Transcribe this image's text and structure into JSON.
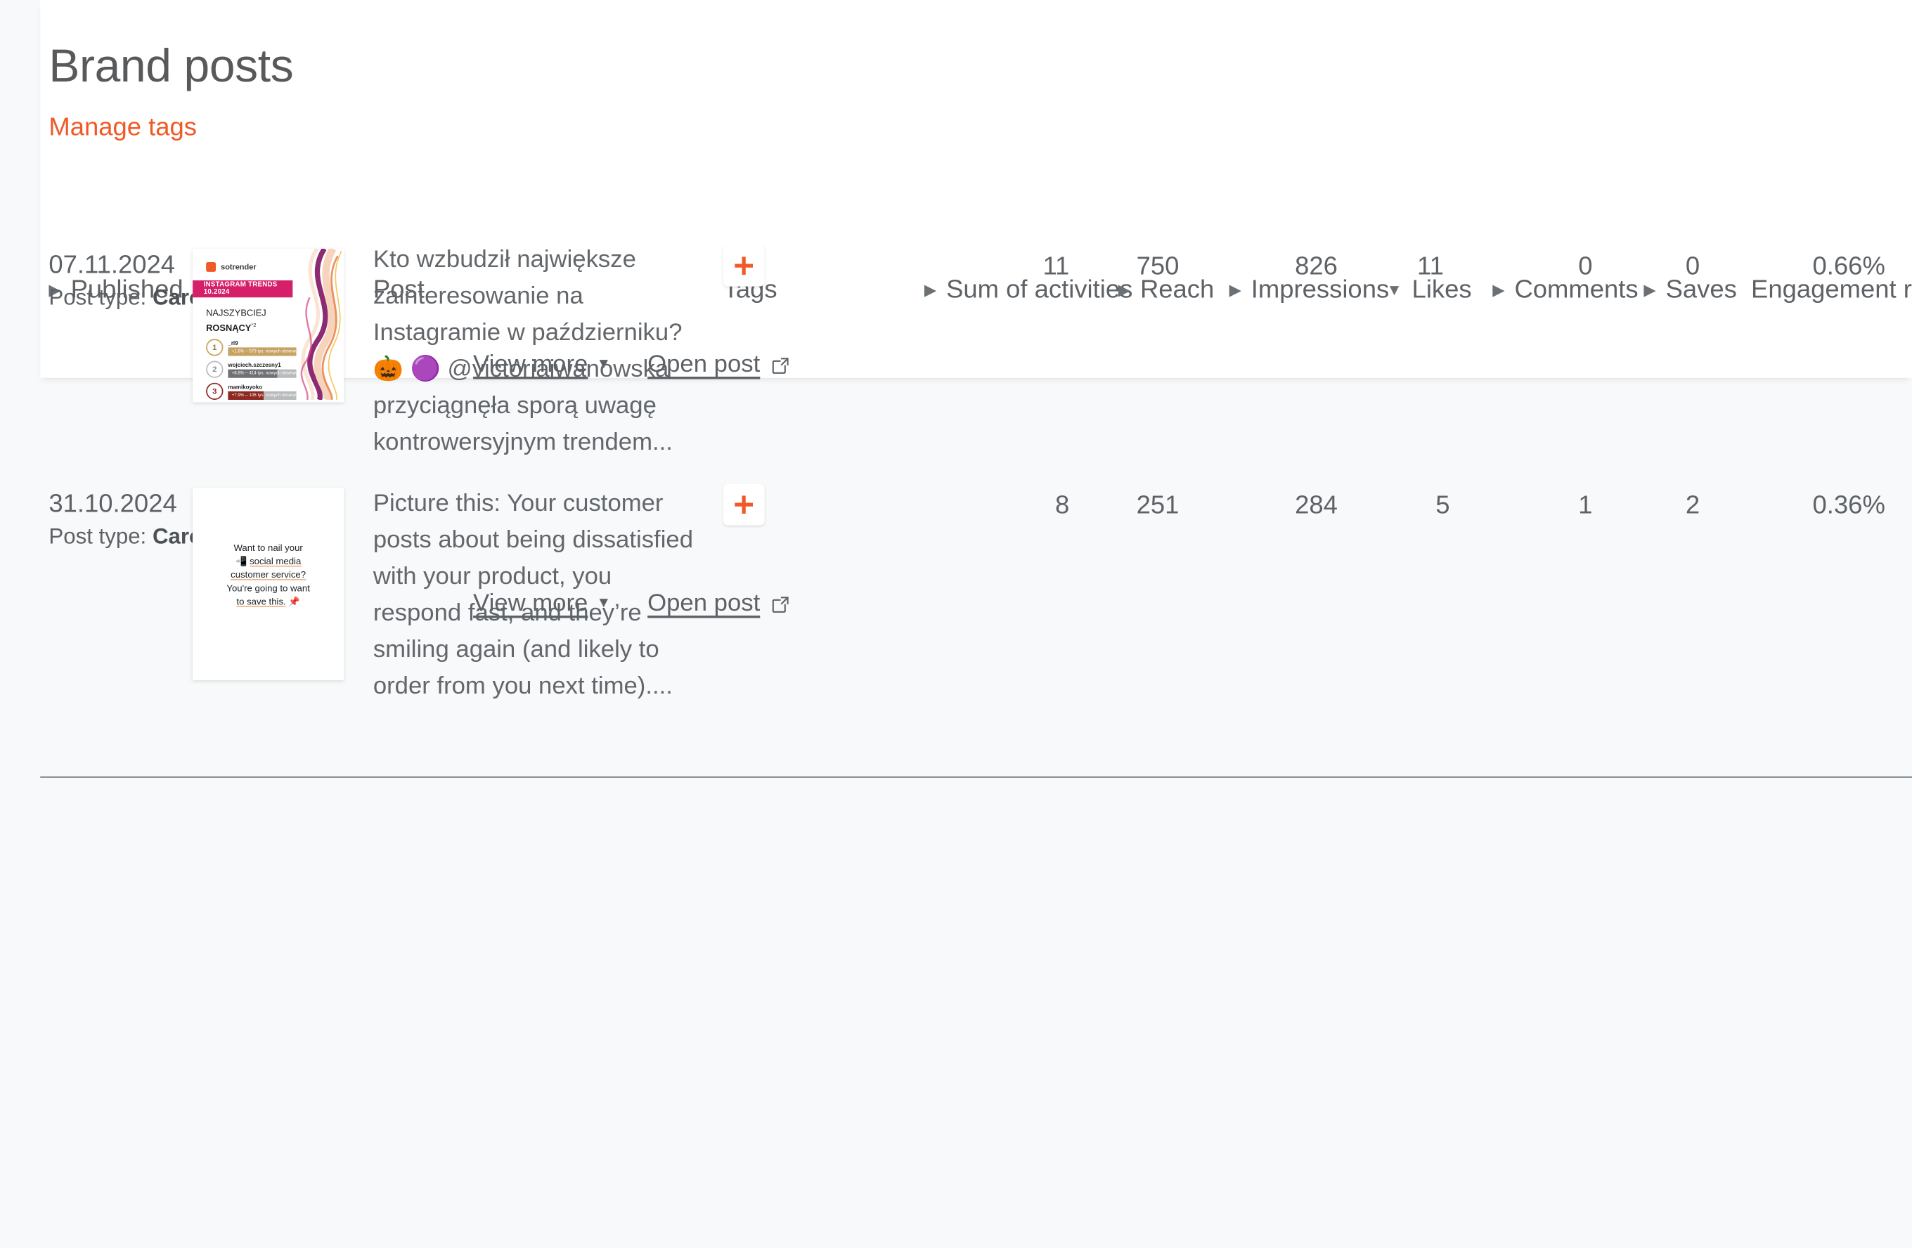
{
  "header": {
    "title": "Brand posts",
    "manage_tags_label": "Manage tags",
    "accent_color": "#ef5a28",
    "title_color": "#58595b"
  },
  "table": {
    "columns": [
      {
        "key": "published",
        "label": "Published",
        "sort_icon": "triangle-right",
        "align": "left"
      },
      {
        "key": "post",
        "label": "Post",
        "sort_icon": "none",
        "align": "left"
      },
      {
        "key": "tags",
        "label": "Tags",
        "sort_icon": "none",
        "align": "left"
      },
      {
        "key": "activities",
        "label": "Sum of activities",
        "sort_icon": "triangle-right",
        "align": "right"
      },
      {
        "key": "reach",
        "label": "Reach",
        "sort_icon": "triangle-right",
        "align": "right"
      },
      {
        "key": "impressions",
        "label": "Impressions",
        "sort_icon": "triangle-right",
        "align": "right"
      },
      {
        "key": "likes",
        "label": "Likes",
        "sort_icon": "triangle-down",
        "align": "right"
      },
      {
        "key": "comments",
        "label": "Comments",
        "sort_icon": "triangle-right",
        "align": "right"
      },
      {
        "key": "saves",
        "label": "Saves",
        "sort_icon": "triangle-right",
        "align": "right"
      },
      {
        "key": "engagement",
        "label": "Engagement rate",
        "sort_icon": "none",
        "align": "right"
      }
    ],
    "sorted_by": "Likes",
    "sort_direction": "descending",
    "post_type_prefix": "Post type:",
    "actions": {
      "view_more_label": "View more",
      "open_post_label": "Open post"
    },
    "add_tag_symbol": "+",
    "rows": [
      {
        "published": "07.11.2024",
        "post_type": "Carousel",
        "text": "Kto wzbudził największe zainteresowanie na Instagramie w październiku? 🎃 🟣 @victoriaiwanowska przyciągnęła sporą uwagę kontrowersyjnym trendem...",
        "activities": "11",
        "reach": "750",
        "impressions": "826",
        "likes": "11",
        "comments": "0",
        "saves": "0",
        "engagement": "0.66%",
        "thumbnail": {
          "kind": "sotrender-infographic",
          "brand": "sotrender",
          "banner": "INSTAGRAM TRENDS 10.2024",
          "headline_line1": "NAJSZYBCIEJ",
          "headline_line2": "ROSNĄCY",
          "headline_sup": "*2",
          "ranking": [
            {
              "place": "1",
              "name": "_rl9",
              "bar": "+1.6% – 573 tys. nowych obserw.",
              "bar_color": "#c6a263",
              "track_color": "#c6a263",
              "fill": 100
            },
            {
              "place": "2",
              "name": "wojciech.szczesny1",
              "bar": "+8.8% – 414 tys. nowych obserw.",
              "bar_color": "#6f7174",
              "track_color": "#b8babc",
              "fill": 72
            },
            {
              "place": "3",
              "name": "mamikoyoko",
              "bar": "+7.9% – 106 tys. nowych obserw.",
              "bar_color": "#8e2820",
              "track_color": "#b8babc",
              "fill": 52
            }
          ]
        }
      },
      {
        "published": "31.10.2024",
        "post_type": "Carousel",
        "text": "Picture this: Your customer posts about being dissatisfied with your product, you respond fast, and they’re smiling again (and likely to order from you next time)....",
        "activities": "8",
        "reach": "251",
        "impressions": "284",
        "likes": "5",
        "comments": "1",
        "saves": "2",
        "engagement": "0.36%",
        "thumbnail": {
          "kind": "text-card",
          "line1": "Want to nail your",
          "line2_emoji": "📲",
          "line2": "social media",
          "line3": "customer service?",
          "line4": "You're going to want",
          "line5": "to save this.",
          "line5_emoji": "📌"
        }
      }
    ]
  }
}
